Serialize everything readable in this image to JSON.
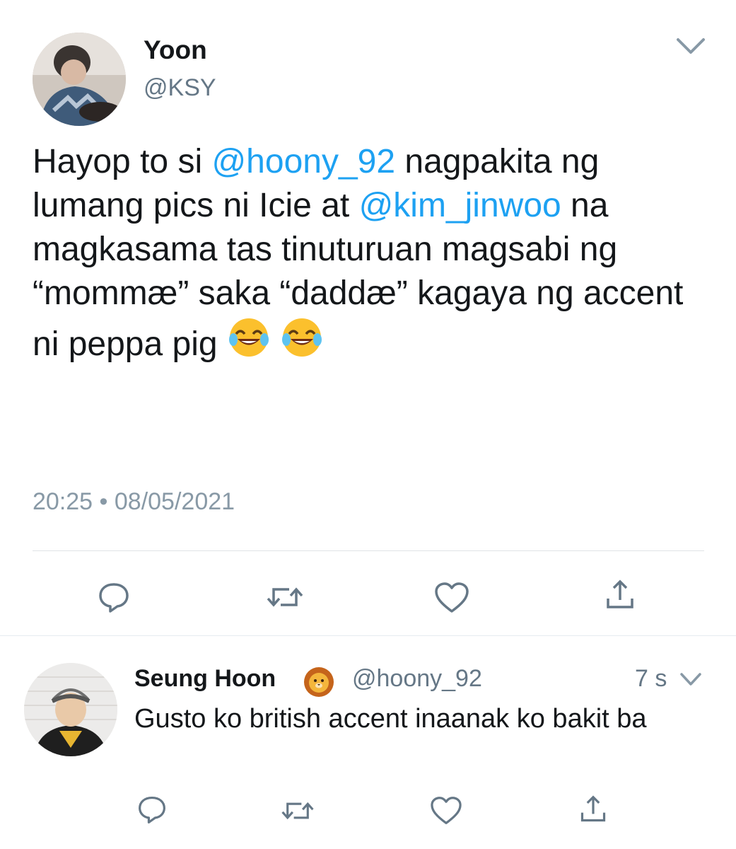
{
  "tweet": {
    "author_name": "Yoon",
    "author_handle": "@KSY",
    "text_parts": {
      "p1": "Hayop to si ",
      "mention1": "@hoony_92",
      "p2": " nagpakita ng lumang pics ni Icie at ",
      "mention2": "@kim_jinwoo",
      "p3": " na magkasama tas tinuturuan magsabi ng “mommæ” saka “daddæ” kagaya ng accent ni peppa pig "
    },
    "emoji": [
      "face-with-tears-of-joy",
      "face-with-tears-of-joy"
    ],
    "time": "20:25 • 08/05/2021"
  },
  "actions": [
    "reply-icon",
    "retweet-icon",
    "like-icon",
    "share-icon"
  ],
  "reply": {
    "author_name": "Seung Hoon",
    "author_emoji": "lion-face",
    "author_handle": "@hoony_92",
    "time": "7 s",
    "text": "Gusto ko british accent inaanak ko bakit ba"
  },
  "colors": {
    "text": "#14171a",
    "secondary": "#657786",
    "mention": "#1da1f2",
    "icon": "#657786"
  }
}
